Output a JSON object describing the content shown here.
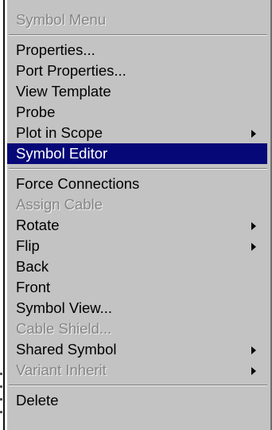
{
  "menu": {
    "header": "Symbol Menu",
    "group1": [
      {
        "label": "Properties..."
      },
      {
        "label": "Port Properties..."
      },
      {
        "label": "View Template"
      },
      {
        "label": "Probe"
      },
      {
        "label": "Plot in Scope",
        "submenu": true
      },
      {
        "label": "Symbol Editor",
        "selected": true
      }
    ],
    "group2": [
      {
        "label": "Force Connections"
      },
      {
        "label": "Assign Cable",
        "disabled": true
      },
      {
        "label": "Rotate",
        "submenu": true
      },
      {
        "label": "Flip",
        "submenu": true
      },
      {
        "label": "Back"
      },
      {
        "label": "Front"
      },
      {
        "label": "Symbol View..."
      },
      {
        "label": "Cable Shield...",
        "disabled": true
      },
      {
        "label": "Shared Symbol",
        "submenu": true
      },
      {
        "label": "Variant Inherit",
        "submenu": true,
        "disabled": true
      }
    ],
    "group3": [
      {
        "label": "Delete"
      }
    ]
  },
  "colors": {
    "menu_background": "#c3c3c3",
    "selection_background": "#070878",
    "selection_text": "#ffffff",
    "disabled_text": "#858585"
  },
  "icons": {
    "submenu_arrow": "triangle-right"
  }
}
